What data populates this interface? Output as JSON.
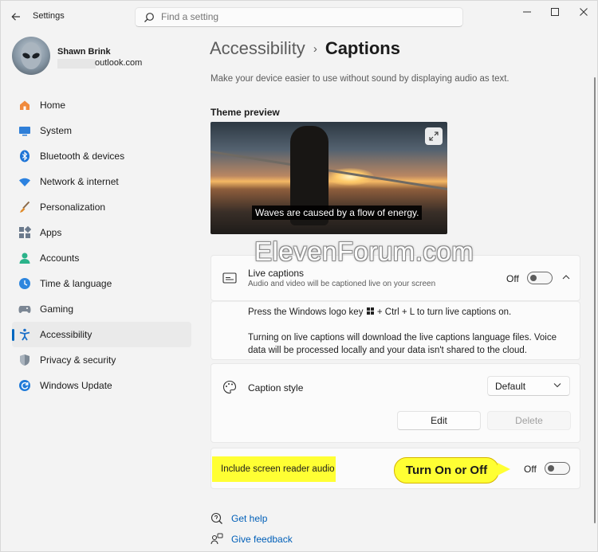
{
  "window": {
    "app_title": "Settings",
    "controls": {
      "minimize": "—",
      "maximize": "☐",
      "close": "✕"
    }
  },
  "search": {
    "placeholder": "Find a setting",
    "value": ""
  },
  "profile": {
    "name": "Shawn Brink",
    "email_suffix": "outlook.com"
  },
  "sidebar": {
    "items": [
      {
        "label": "Home",
        "icon": "home-icon",
        "active": false
      },
      {
        "label": "System",
        "icon": "monitor-icon",
        "active": false
      },
      {
        "label": "Bluetooth & devices",
        "icon": "bluetooth-icon",
        "active": false
      },
      {
        "label": "Network & internet",
        "icon": "wifi-icon",
        "active": false
      },
      {
        "label": "Personalization",
        "icon": "brush-icon",
        "active": false
      },
      {
        "label": "Apps",
        "icon": "apps-icon",
        "active": false
      },
      {
        "label": "Accounts",
        "icon": "person-icon",
        "active": false
      },
      {
        "label": "Time & language",
        "icon": "clock-globe-icon",
        "active": false
      },
      {
        "label": "Gaming",
        "icon": "gamepad-icon",
        "active": false
      },
      {
        "label": "Accessibility",
        "icon": "accessibility-icon",
        "active": true
      },
      {
        "label": "Privacy & security",
        "icon": "shield-icon",
        "active": false
      },
      {
        "label": "Windows Update",
        "icon": "update-icon",
        "active": false
      }
    ]
  },
  "header": {
    "parent": "Accessibility",
    "separator": "›",
    "current": "Captions",
    "subtitle": "Make your device easier to use without sound by displaying audio as text."
  },
  "theme_preview": {
    "title": "Theme preview",
    "caption": "Waves are caused by a flow of energy."
  },
  "live_captions": {
    "title": "Live captions",
    "description": "Audio and video will be captioned live on your screen",
    "state": "Off",
    "info_line1_before": "Press the Windows logo key",
    "info_line1_after": "+ Ctrl + L to turn live captions on.",
    "info_line2": "Turning on live captions will download the live captions language files. Voice",
    "info_line3": "data will be processed locally and your data isn't shared to the cloud."
  },
  "caption_style": {
    "title": "Caption style",
    "selected": "Default",
    "edit_label": "Edit",
    "delete_label": "Delete"
  },
  "screen_reader": {
    "label": "Include screen reader audio",
    "state": "Off"
  },
  "callout": {
    "text": "Turn On or Off"
  },
  "watermark": {
    "text": "ElevenForum.com"
  },
  "links": {
    "help": "Get help",
    "feedback": "Give feedback"
  },
  "colors": {
    "accent": "#0067c0",
    "link": "#005fb8",
    "highlight": "#ffff33"
  }
}
